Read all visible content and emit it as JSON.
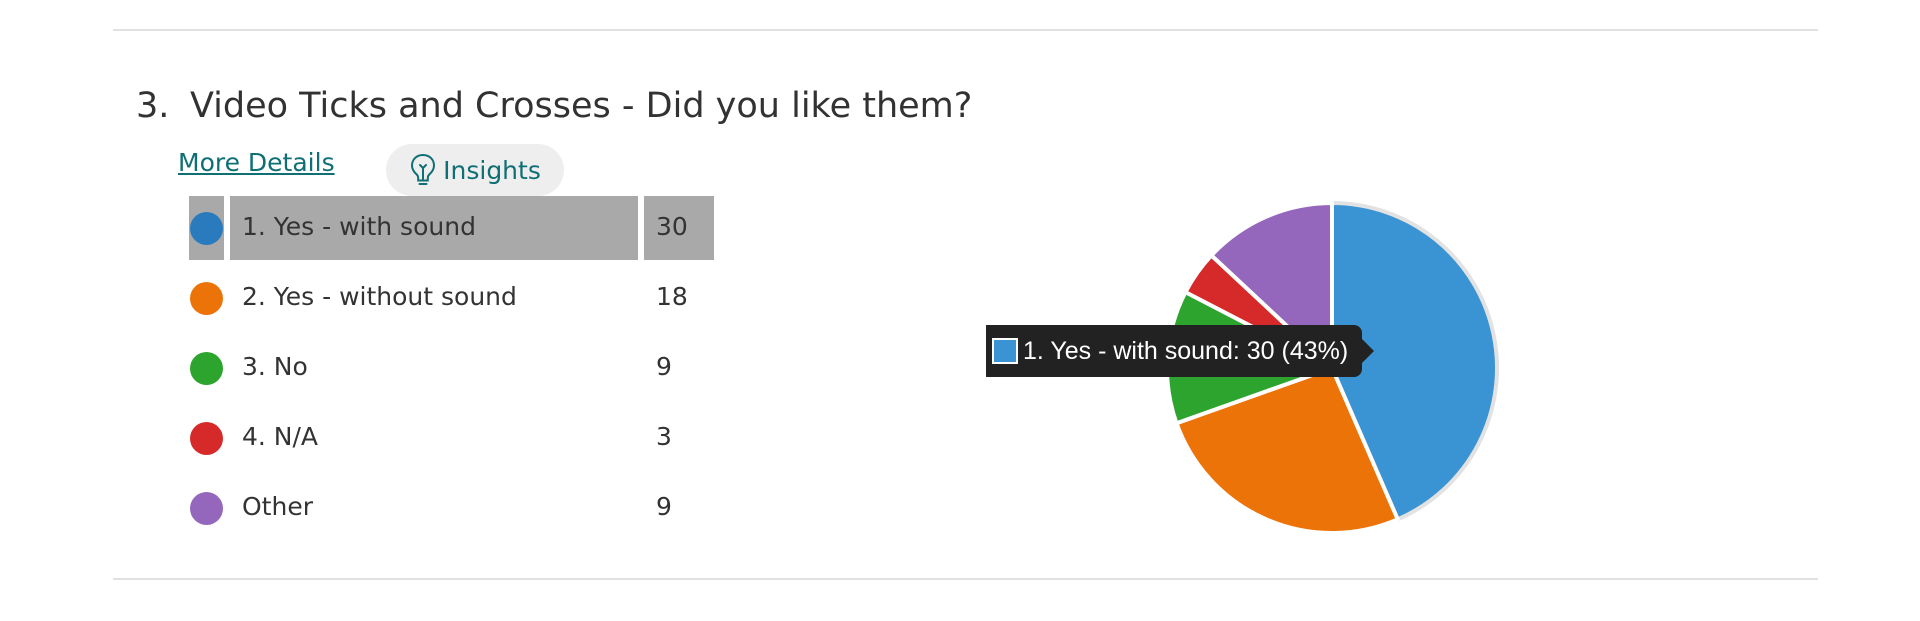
{
  "question": {
    "number": "3.",
    "title": "Video Ticks and Crosses - Did you like them?",
    "more_details": "More Details",
    "insights": "Insights"
  },
  "legend": {
    "items": [
      {
        "label": "1. Yes - with sound",
        "count": "30",
        "color": "#3a93d2",
        "dot_color": "#2a7bbe",
        "selected": true
      },
      {
        "label": "2. Yes - without sound",
        "count": "18",
        "color": "#ec7308",
        "dot_color": "#ec7308",
        "selected": false
      },
      {
        "label": "3. No",
        "count": "9",
        "color": "#2ca42e",
        "dot_color": "#2ca42e",
        "selected": false
      },
      {
        "label": "4. N/A",
        "count": "3",
        "color": "#d62a2a",
        "dot_color": "#d62a2a",
        "selected": false
      },
      {
        "label": "Other",
        "count": "9",
        "color": "#9467bd",
        "dot_color": "#9467bd",
        "selected": false
      }
    ]
  },
  "tooltip": {
    "text": "1. Yes - with sound: 30 (43%)",
    "swatch_color": "#3a93d2"
  },
  "chart_data": {
    "type": "pie",
    "categories": [
      "1. Yes - with sound",
      "2. Yes - without sound",
      "3. No",
      "4. N/A",
      "Other"
    ],
    "values": [
      30,
      18,
      9,
      3,
      9
    ],
    "colors": [
      "#3a93d2",
      "#ec7308",
      "#2ca42e",
      "#d62a2a",
      "#9467bd"
    ],
    "highlighted": "1. Yes - with sound"
  }
}
